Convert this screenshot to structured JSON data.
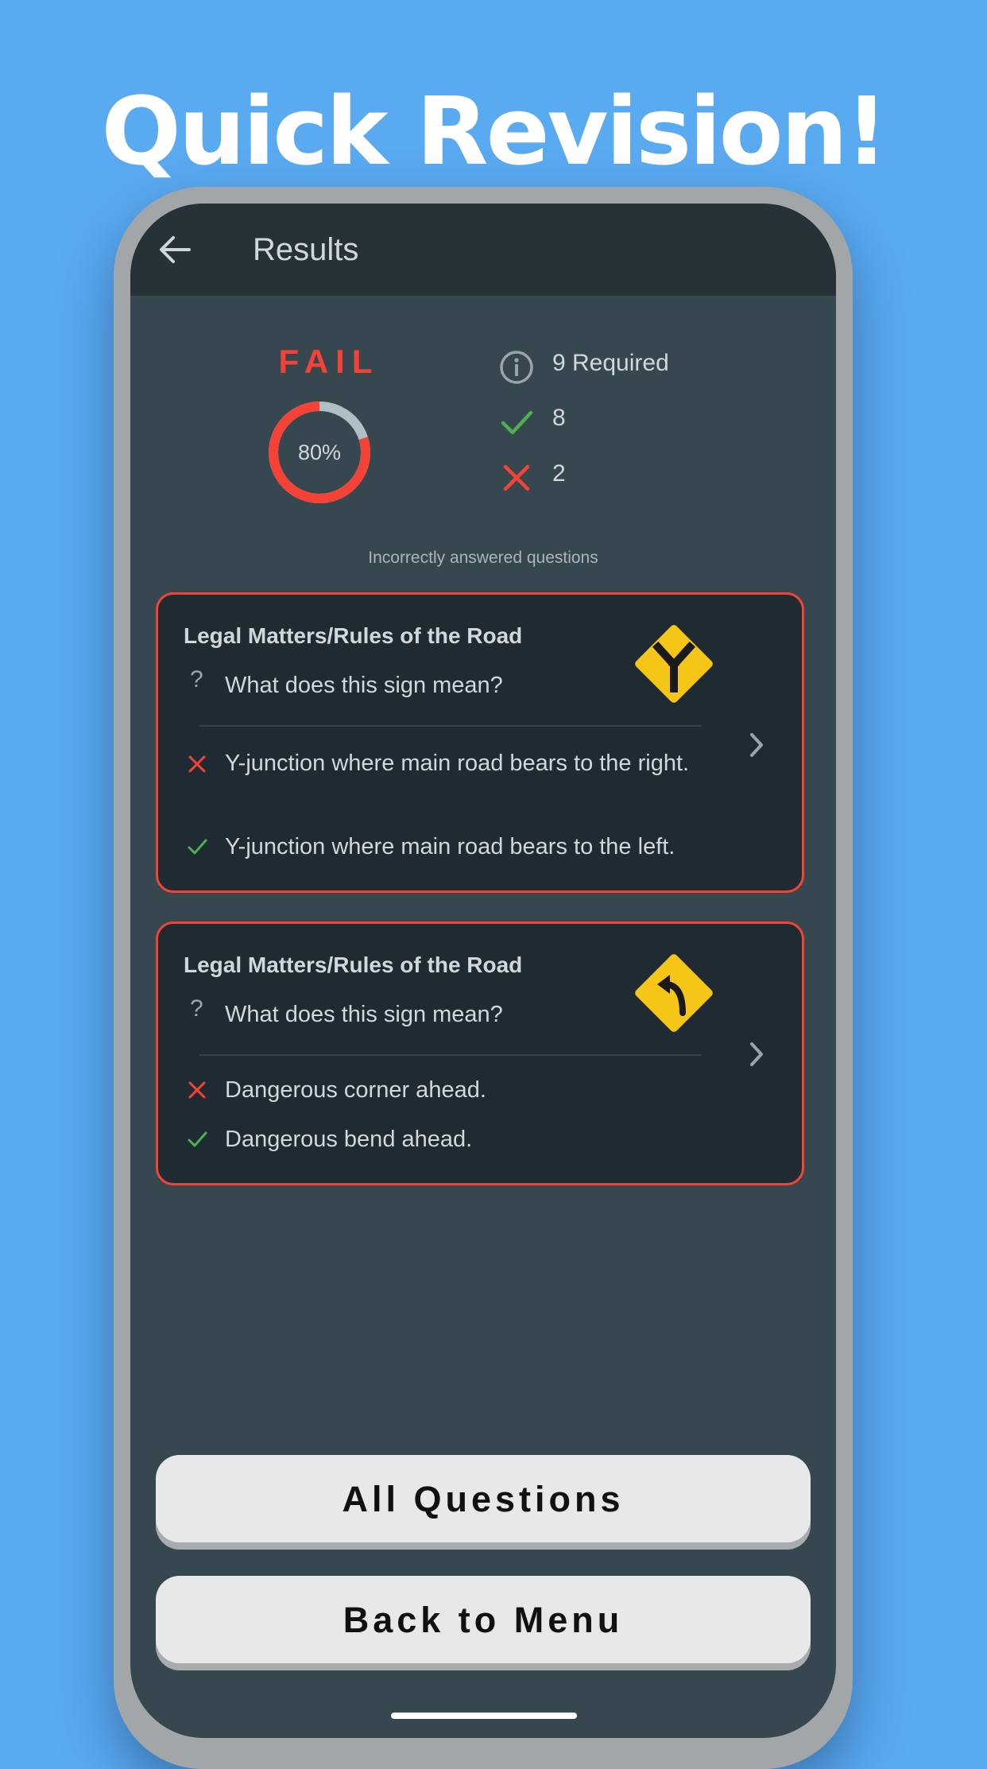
{
  "promo": {
    "headline": "Quick Revision!"
  },
  "appbar": {
    "title": "Results",
    "back_icon": "arrow-left-icon"
  },
  "result": {
    "status": "FAIL",
    "score_percent": 80,
    "score_label": "80%",
    "required_label": "9 Required",
    "correct_count": "8",
    "incorrect_count": "2"
  },
  "section_label": "Incorrectly answered questions",
  "questions": [
    {
      "category": "Legal Matters/Rules of the Road",
      "question": "What does this sign mean?",
      "wrong_answer": "Y-junction where main road bears to the right.",
      "correct_answer": "Y-junction where main road bears to the left.",
      "sign_icon": "y-junction-sign"
    },
    {
      "category": "Legal Matters/Rules of the Road",
      "question": "What does this sign mean?",
      "wrong_answer": "Dangerous corner ahead.",
      "correct_answer": "Dangerous bend ahead.",
      "sign_icon": "bend-left-sign"
    }
  ],
  "buttons": {
    "all_questions": "All Questions",
    "back_to_menu": "Back to Menu"
  },
  "colors": {
    "background": "#5aaaf2",
    "fail": "#f44336",
    "correct": "#4caf50",
    "sign_yellow": "#f5c518",
    "card": "#1f2a33",
    "screen": "#37474f"
  }
}
